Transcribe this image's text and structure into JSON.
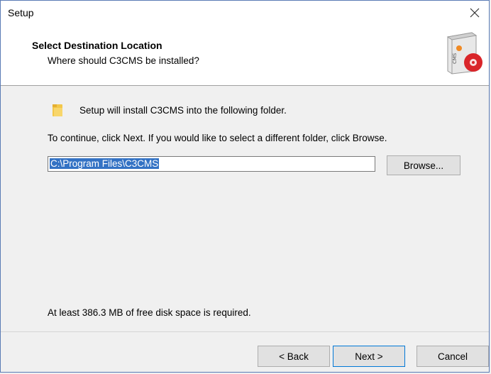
{
  "window": {
    "title": "Setup"
  },
  "header": {
    "title": "Select Destination Location",
    "subtitle": "Where should C3CMS be installed?",
    "logo_text": "CMS"
  },
  "body": {
    "intro": "Setup will install C3CMS into the following folder.",
    "continue": "To continue, click Next. If you would like to select a different folder, click Browse.",
    "path_value": "C:\\Program Files\\C3CMS",
    "browse_label": "Browse...",
    "disk_space": "At least 386.3 MB of free disk space is required."
  },
  "footer": {
    "back_label": "< Back",
    "next_label": "Next >",
    "cancel_label": "Cancel"
  },
  "colors": {
    "selection": "#3372c4",
    "default_button_border": "#0078d7",
    "logo_red": "#d9252a",
    "logo_orange": "#f08a24"
  }
}
